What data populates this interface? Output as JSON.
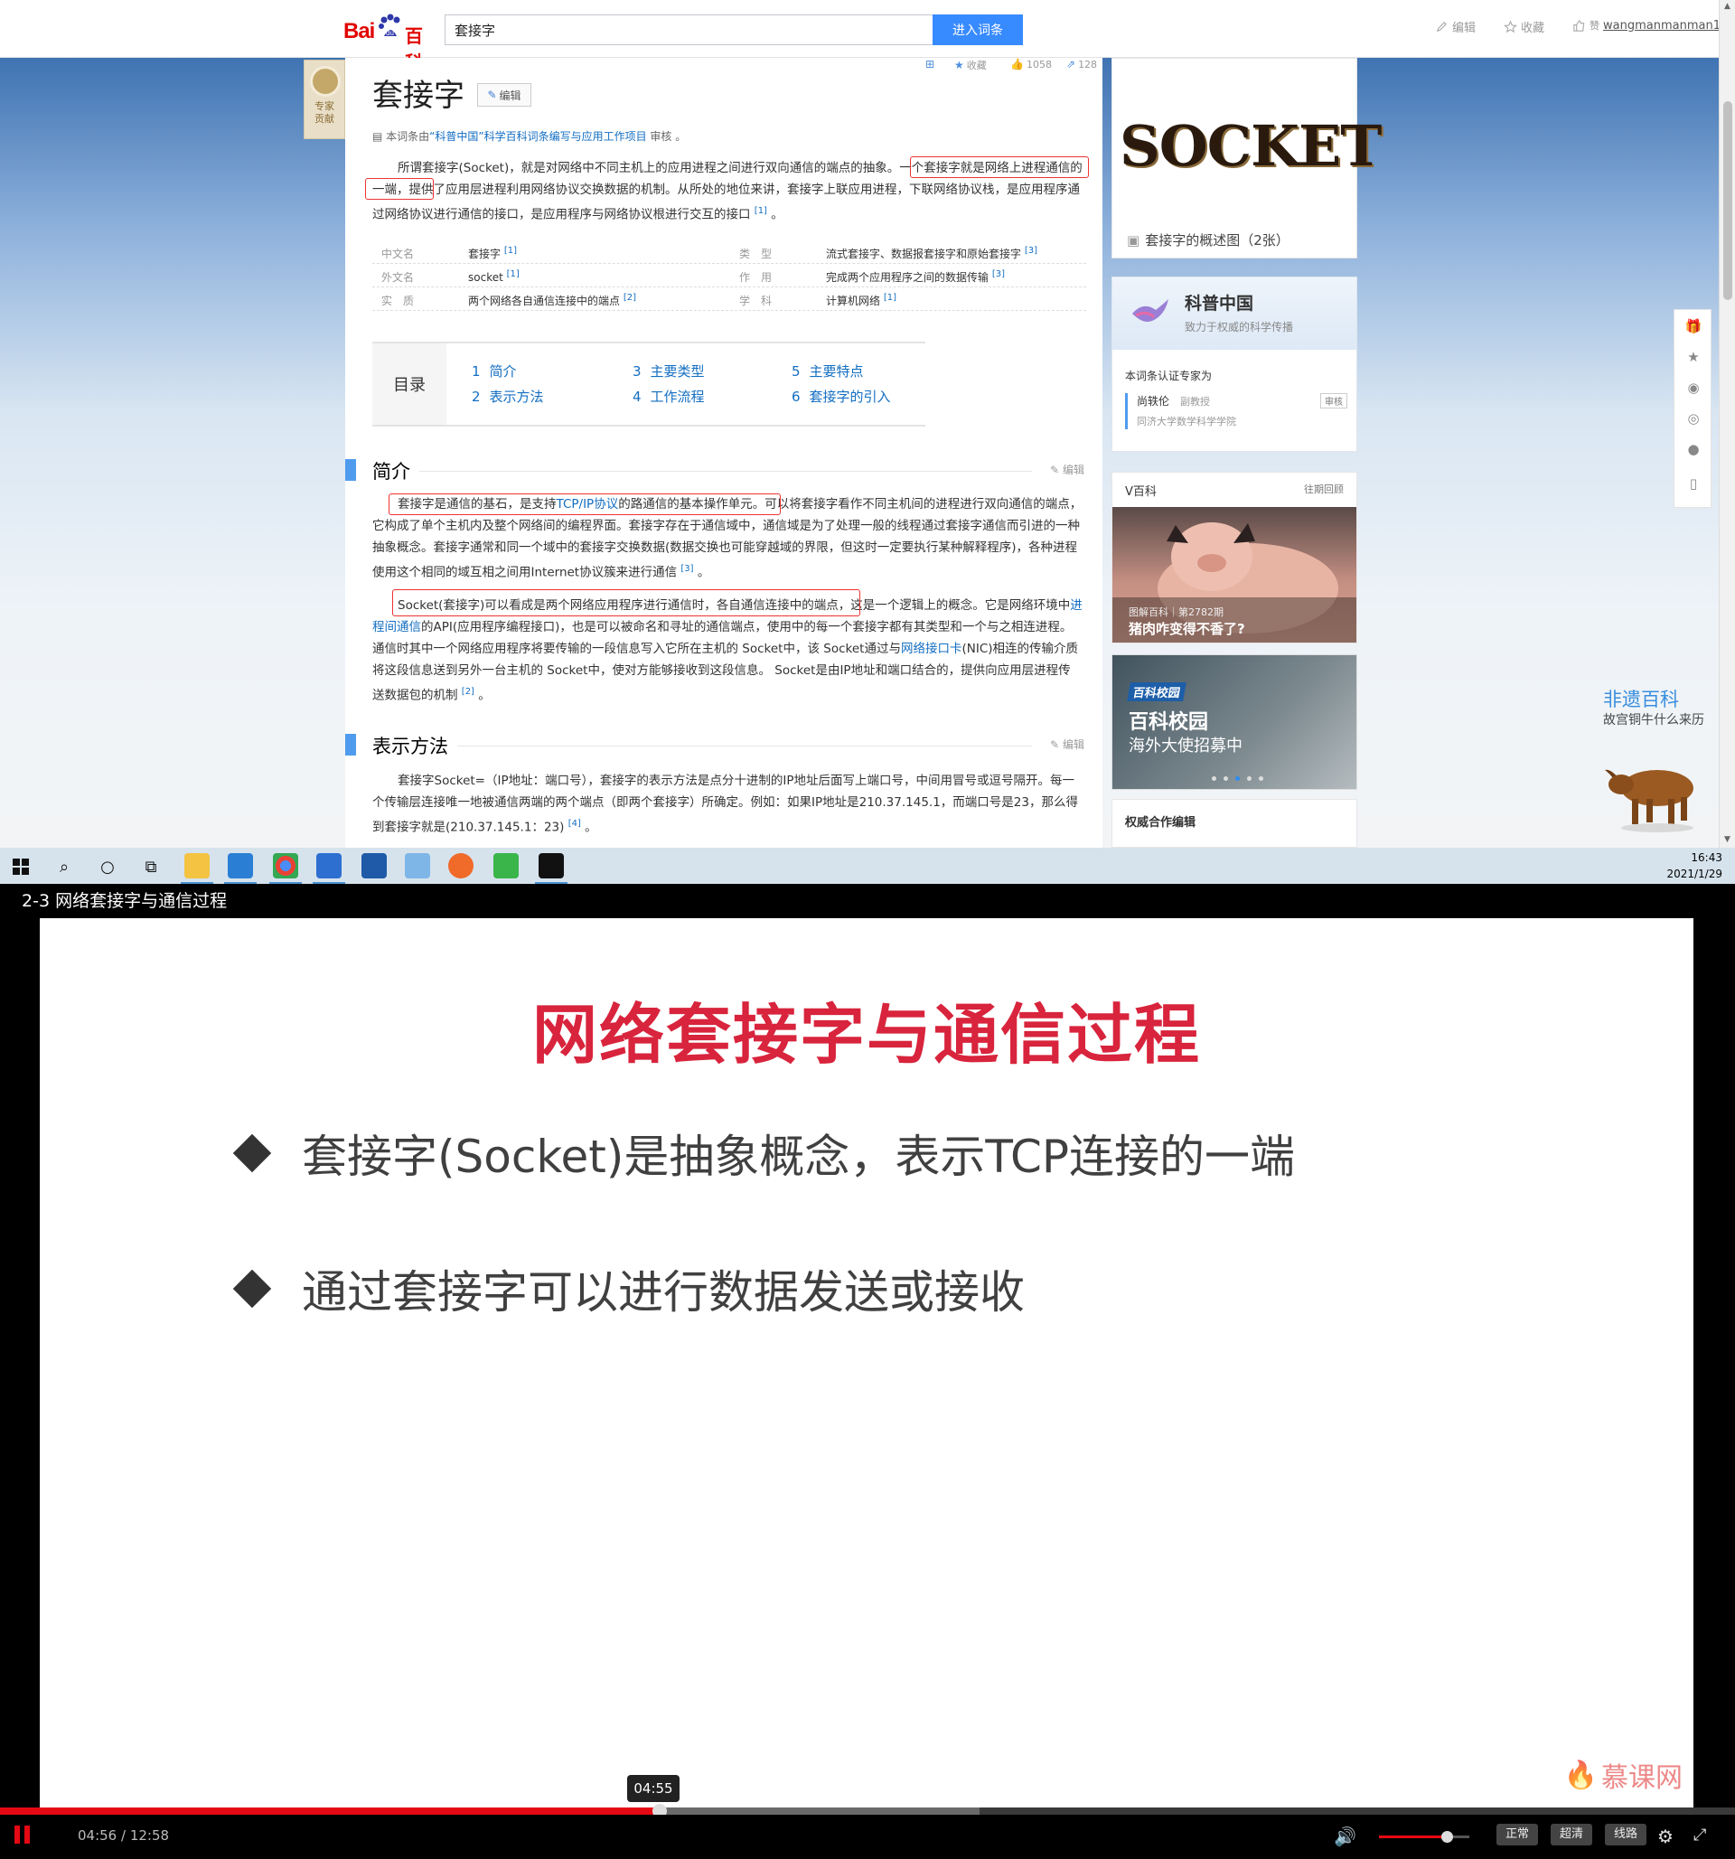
{
  "browser": {
    "logo": {
      "bai": "Bai",
      "du": "du",
      "baike": "百科"
    },
    "search": {
      "value": "套接字",
      "button": "进入词条"
    },
    "top_actions": {
      "edit": "编辑",
      "collect": "收藏",
      "user": "wangmanmanman1"
    }
  },
  "article": {
    "expert_tab": "专家\n贡献",
    "title": "套接字",
    "edit_btn": "编辑",
    "meta": {
      "collect": "收藏",
      "likes": "1058",
      "shares": "128"
    },
    "reviewed": {
      "prefix": "本词条由",
      "link": "“科普中国”科学百科词条编写与应用工作项目",
      "suffix": " 审核 。"
    },
    "summary": {
      "p1": "所谓套接字(Socket)，就是对网络中不同主机上的应用进程之间进行双向通信的端点的抽象。一个套接字就是网络上进程通信的一端，提供了应用层进程利用网络协议交换数据的机制。从所处的地位来讲，套接字上联应用进程，下联网络协议栈，是应用程序通过网络协议进行通信的接口，是应用程序与网络协议根进行交互的接口",
      "ref": "[1]",
      "end": " 。"
    },
    "basic_info": [
      {
        "name": "中文名",
        "value": "套接字",
        "ref": "[1]",
        "name2": "类　型",
        "value2": "流式套接字、数据报套接字和原始套接字",
        "ref2": "[3]"
      },
      {
        "name": "外文名",
        "value": "socket",
        "ref": "[1]",
        "name2": "作　用",
        "value2": "完成两个应用程序之间的数据传输",
        "ref2": "[3]"
      },
      {
        "name": "实　质",
        "value": "两个网络各自通信连接中的端点",
        "ref": "[2]",
        "name2": "学　科",
        "value2": "计算机网络",
        "ref2": "[1]"
      }
    ],
    "toc": {
      "label": "目录",
      "items": [
        {
          "num": "1",
          "label": "简介"
        },
        {
          "num": "2",
          "label": "表示方法"
        },
        {
          "num": "3",
          "label": "主要类型"
        },
        {
          "num": "4",
          "label": "工作流程"
        },
        {
          "num": "5",
          "label": "主要特点"
        },
        {
          "num": "6",
          "label": "套接字的引入"
        }
      ]
    },
    "sections": [
      {
        "title": "简介",
        "edit": "编辑"
      },
      {
        "title": "表示方法",
        "edit": "编辑"
      }
    ],
    "intro_p1": {
      "a": "套接字是通信的基石，是支持",
      "link": "TCP/IP协议",
      "b": "的路通信的基本操作单元。可以将套接字看作不同主机间的进程进行双向通信的端点，它构成了单个主机内及整个网络间的编程界面。套接字存在于通信域中，通信域是为了处理一般的线程通过套接字通信而引进的一种抽象概念。套接字通常和同一个域中的套接字交换数据(数据交换也可能穿越域的界限，但这时一定要执行某种解释程序)，各种进程使用这个相同的域互相之间用Internet协议簇来进行通信",
      "ref": "[3]",
      "end": " 。"
    },
    "intro_p2": {
      "a": "Socket(套接字)可以看成是两个网络应用程序进行通信时，各自通信连接中的端点，这是一个逻辑上的概念。它是网络环境中",
      "link1": "进程间通信",
      "b": "的API(应用程序编程接口)，也是可以被命名和寻址的通信端点，使用中的每一个套接字都有其类型和一个与之相连进程。通信时其中一个网络应用程序将要传输的一段信息写入它所在主机的 Socket中，该 Socket通过与",
      "link2": "网络接口卡",
      "c": "(NIC)相连的传输介质将这段信息送到另外一台主机的 Socket中，使对方能够接收到这段信息。 Socket是由IP地址和端口结合的，提供向应用层进程传送数据包的机制",
      "ref": "[2]",
      "end": " 。"
    },
    "repr_p1": {
      "text": "套接字Socket=（IP地址：端口号），套接字的表示方法是点分十进制的IP地址后面写上端口号，中间用冒号或逗号隔开。每一个传输层连接唯一地被通信两端的两个端点（即两个套接字）所确定。例如：如果IP地址是210.37.145.1，而端口号是23，那么得到套接字就是(210.37.145.1：23)",
      "ref": "[4]",
      "end": " 。"
    }
  },
  "sidebar": {
    "socket_image_text": "SOCKET",
    "album": "套接字的概述图（2张）",
    "kepu": {
      "title": "科普中国",
      "sub": "致力于权威的科学传播",
      "cert": "本词条认证专家为",
      "name": "尚轶伦",
      "rank": "副教授",
      "org": "同济大学数学科学学院",
      "review": "审核"
    },
    "vbaike": {
      "title": "V百科",
      "more": "往期回顾",
      "cap1": "图解百科｜第2782期",
      "cap2": "猪肉咋变得不香了?"
    },
    "campus": {
      "tag": "百科校园",
      "t1": "百科校园",
      "t2": "海外大使招募中"
    },
    "authority": "权威合作编辑",
    "feiyi": {
      "t1": "非遗百科",
      "t2": "故宫铜牛什么来历"
    }
  },
  "taskbar": {
    "time": "16:43",
    "date": "2021/1/29"
  },
  "player": {
    "title": "2-3 网络套接字与通信过程",
    "slide_title": "网络套接字与通信过程",
    "bullets": [
      "套接字(Socket)是抽象概念，表示TCP连接的一端",
      "通过套接字可以进行数据发送或接收"
    ],
    "watermark": "慕课网",
    "hover_time": "04:55",
    "time_label": "04:56 / 12:58",
    "progress": 0.38,
    "volume": 0.75,
    "buttons": {
      "normal": "正常",
      "hd": "超清",
      "route": "线路"
    }
  },
  "colors": {
    "accent": "#e50914",
    "link": "#136ec2",
    "slide_title": "#d8243c"
  }
}
